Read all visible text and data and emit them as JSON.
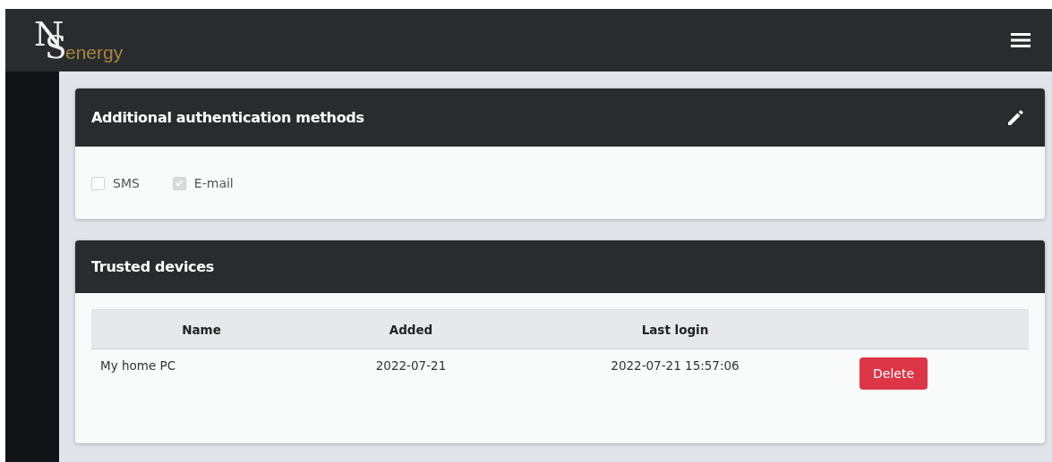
{
  "navbar": {
    "logo": {
      "letters": [
        "N",
        "S"
      ],
      "text": "energy"
    }
  },
  "auth_card": {
    "title": "Additional authentication methods",
    "options": [
      {
        "label": "SMS",
        "checked": false,
        "disabled": true
      },
      {
        "label": "E-mail",
        "checked": true,
        "disabled": true
      }
    ]
  },
  "devices_card": {
    "title": "Trusted devices",
    "table": {
      "columns": [
        "Name",
        "Added",
        "Last login"
      ],
      "rows": [
        {
          "cells": [
            "My home PC",
            "2022-07-21",
            "2022-07-21 15:57:06"
          ],
          "action": "Delete"
        }
      ]
    }
  }
}
